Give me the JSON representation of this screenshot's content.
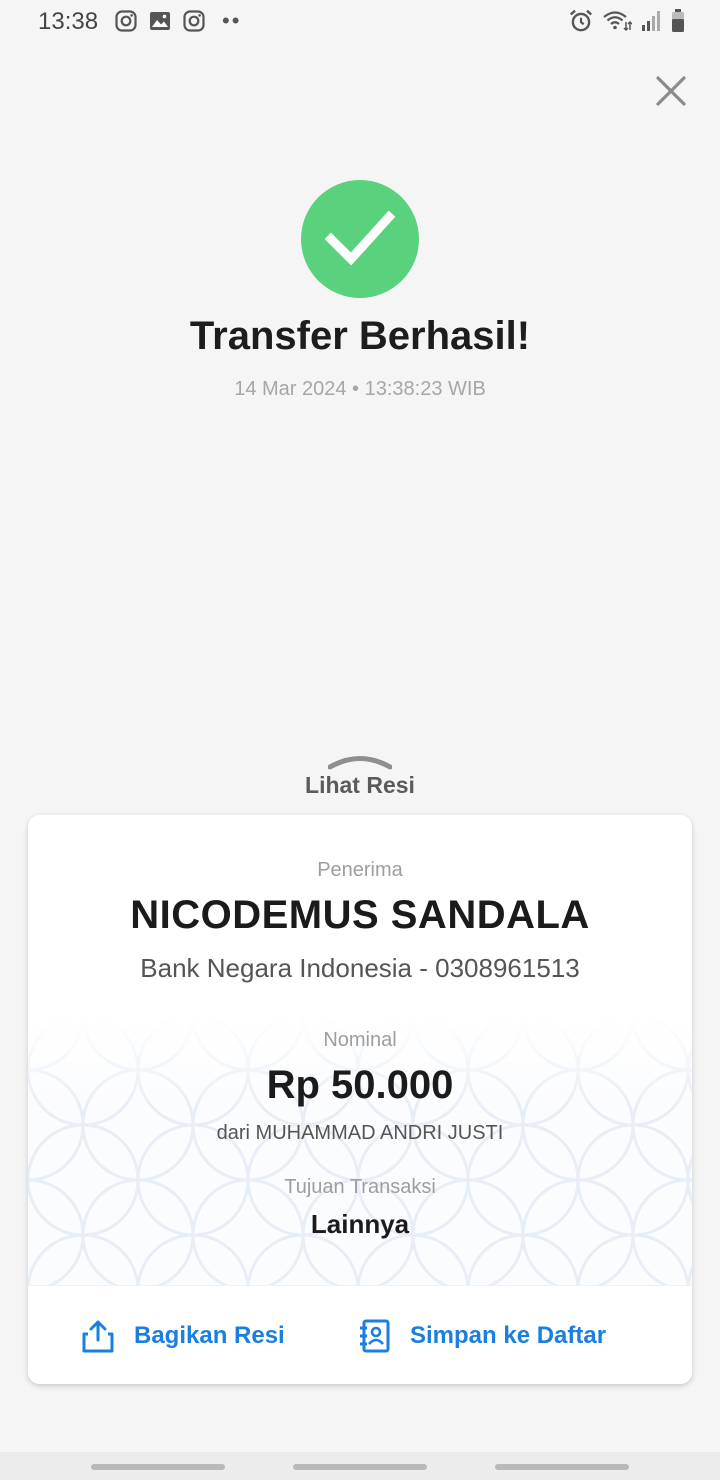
{
  "status_bar": {
    "time": "13:38",
    "left_icons": [
      "instagram-icon",
      "gallery-icon",
      "instagram-icon"
    ],
    "dots": "••",
    "right_icons": [
      "alarm-icon",
      "wifi-icon",
      "signal-icon",
      "battery-icon"
    ]
  },
  "header": {
    "title": "Transfer Berhasil!",
    "timestamp": "14 Mar 2024 • 13:38:23 WIB",
    "success_color": "#5ad17c"
  },
  "receipt_toggle": {
    "label": "Lihat Resi"
  },
  "receipt": {
    "recipient_label": "Penerima",
    "recipient_name": "NICODEMUS SANDALA",
    "bank_line": "Bank Negara Indonesia - 0308961513",
    "amount_label": "Nominal",
    "amount": "Rp 50.000",
    "from_line": "dari MUHAMMAD ANDRI JUSTI",
    "purpose_label": "Tujuan Transaksi",
    "purpose": "Lainnya"
  },
  "actions": {
    "share_label": "Bagikan Resi",
    "save_label": "Simpan ke Daftar",
    "accent": "#1a7fe0"
  }
}
